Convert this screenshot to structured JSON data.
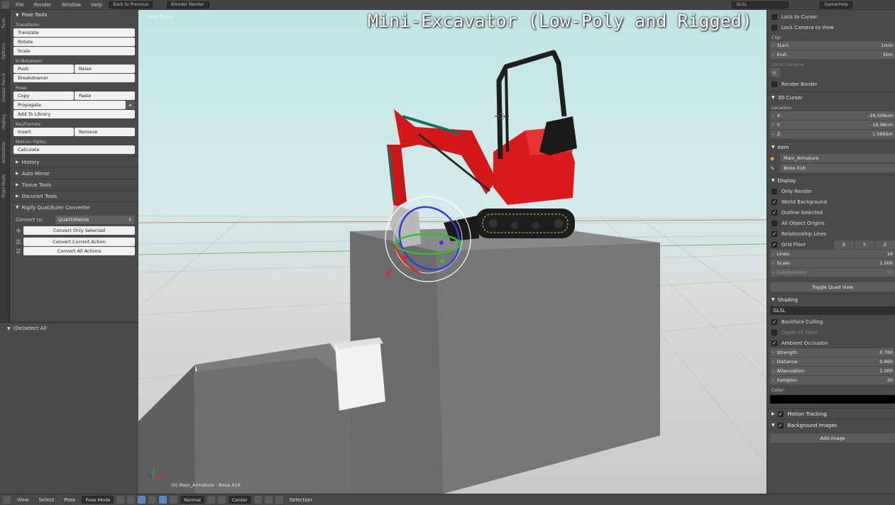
{
  "video_title": "Mini-Excavator (Low-Poly and Rigged)",
  "topbar": {
    "menus": [
      "File",
      "Render",
      "Window",
      "Help"
    ],
    "back_button": "Back to Previous",
    "render_engine": "Blender Render",
    "shading": "GLSL",
    "right_label": "Game/Help"
  },
  "left_tabs": [
    "Tools",
    "Options",
    "Grease Pencil",
    "Display",
    "Animation",
    "Rigid Mode"
  ],
  "pose_tools": {
    "header": "Pose Tools",
    "transform_label": "Transform:",
    "translate": "Translate",
    "rotate": "Rotate",
    "scale": "Scale",
    "in_between_label": "In-Between:",
    "push": "Push",
    "relax": "Relax",
    "breakdowner": "Breakdowner",
    "pose_label": "Pose:",
    "copy": "Copy",
    "paste": "Paste",
    "propagate": "Propagate",
    "add_to_library": "Add To Library",
    "keyframes_label": "Keyframes:",
    "insert": "Insert",
    "remove": "Remove",
    "motion_paths_label": "Motion Paths:",
    "calculate": "Calculate"
  },
  "collapsed_panels": [
    "History",
    "Auto Mirror",
    "Tissue Tools",
    "Oscurart Tools"
  ],
  "rigify": {
    "header": "Rigify Quat/Euler Converter",
    "convert_to_label": "Convert to:",
    "convert_to_value": "QUATERNION",
    "convert_only_selected": "Convert Only Selected",
    "convert_current_action": "Convert Current Action",
    "convert_all_actions": "Convert All Actions"
  },
  "operator_header": "(De)select All",
  "viewport": {
    "view_label": "User Persp",
    "object_label": "(0) Main_Armature : Bone.016"
  },
  "right_panel": {
    "lock_to_cursor": "Lock to Cursor",
    "lock_camera_to_view": "Lock Camera to View",
    "clip_label": "Clip:",
    "clip_start_label": "Start:",
    "clip_start_value": "1mm",
    "clip_end_label": "End:",
    "clip_end_value": "1km",
    "local_camera_label": "Local Camera:",
    "render_border": "Render Border",
    "cursor_header": "3D Cursor",
    "location_label": "Location:",
    "cursor_x_label": "X:",
    "cursor_x": "-26.506cm",
    "cursor_y_label": "Y:",
    "cursor_y": "-16.98cm",
    "cursor_z_label": "Z:",
    "cursor_z": "1.5695m",
    "item_header": "Item",
    "item_object": "Main_Armature",
    "item_bone": "Bone.016",
    "display_header": "Display",
    "only_render": "Only Render",
    "world_background": "World Background",
    "outline_selected": "Outline Selected",
    "all_object_origins": "All Object Origins",
    "relationship_lines": "Relationship Lines",
    "grid_floor": "Grid Floor",
    "axis_x": "X",
    "axis_y": "Y",
    "axis_z": "Z",
    "lines_label": "Lines:",
    "lines_value": "16",
    "scale_label": "Scale:",
    "scale_value": "1.000",
    "subdivisions_label": "Subdivisions:",
    "subdivisions_value": "10",
    "toggle_quad_view": "Toggle Quad View",
    "shading_header": "Shading",
    "shading_mode": "GLSL",
    "backface_culling": "Backface Culling",
    "depth_of_field": "Depth Of Field",
    "ambient_occlusion": "Ambient Occlusion",
    "strength_label": "Strength:",
    "strength_value": "0.700",
    "distance_label": "Distance:",
    "distance_value": "0.860",
    "attenuation_label": "Attenuation:",
    "attenuation_value": "1.000",
    "samples_label": "Samples:",
    "samples_value": "20",
    "color_label": "Color:",
    "color_value": "#000000",
    "motion_tracking": "Motion Tracking",
    "background_images": "Background Images",
    "add_image": "Add Image"
  },
  "bottombar": {
    "menus": [
      "View",
      "Select",
      "Pose"
    ],
    "mode": "Pose Mode",
    "orientation": "Normal",
    "pivot": "Center",
    "selection_label": "Selection"
  }
}
